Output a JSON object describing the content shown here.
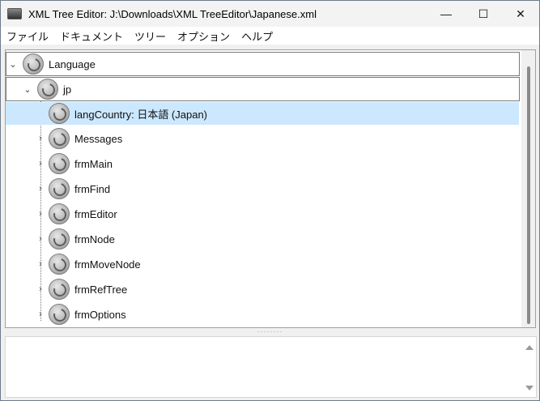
{
  "window": {
    "title": "XML Tree Editor: J:\\Downloads\\XML TreeEditor\\Japanese.xml",
    "minimize_glyph": "—",
    "maximize_glyph": "☐",
    "close_glyph": "✕"
  },
  "menu": {
    "items": [
      "ファイル",
      "ドキュメント",
      "ツリー",
      "オプション",
      "ヘルプ"
    ]
  },
  "tree": {
    "root_label": "Language",
    "child_label": "jp",
    "children": [
      {
        "label": "langCountry: 日本語 (Japan)",
        "selected": true,
        "expandable": false
      },
      {
        "label": "Messages",
        "expandable": true
      },
      {
        "label": "frmMain",
        "expandable": true
      },
      {
        "label": "frmFind",
        "expandable": true
      },
      {
        "label": "frmEditor",
        "expandable": true
      },
      {
        "label": "frmNode",
        "expandable": true
      },
      {
        "label": "frmMoveNode",
        "expandable": true
      },
      {
        "label": "frmRefTree",
        "expandable": true
      },
      {
        "label": "frmOptions",
        "expandable": true
      }
    ]
  },
  "splitter": {
    "grip": "········"
  },
  "icons": {
    "node": "gear-node-icon",
    "expand": "chevron-right-icon",
    "collapse": "chevron-down-icon"
  },
  "colors": {
    "selection": "#cce8ff"
  }
}
